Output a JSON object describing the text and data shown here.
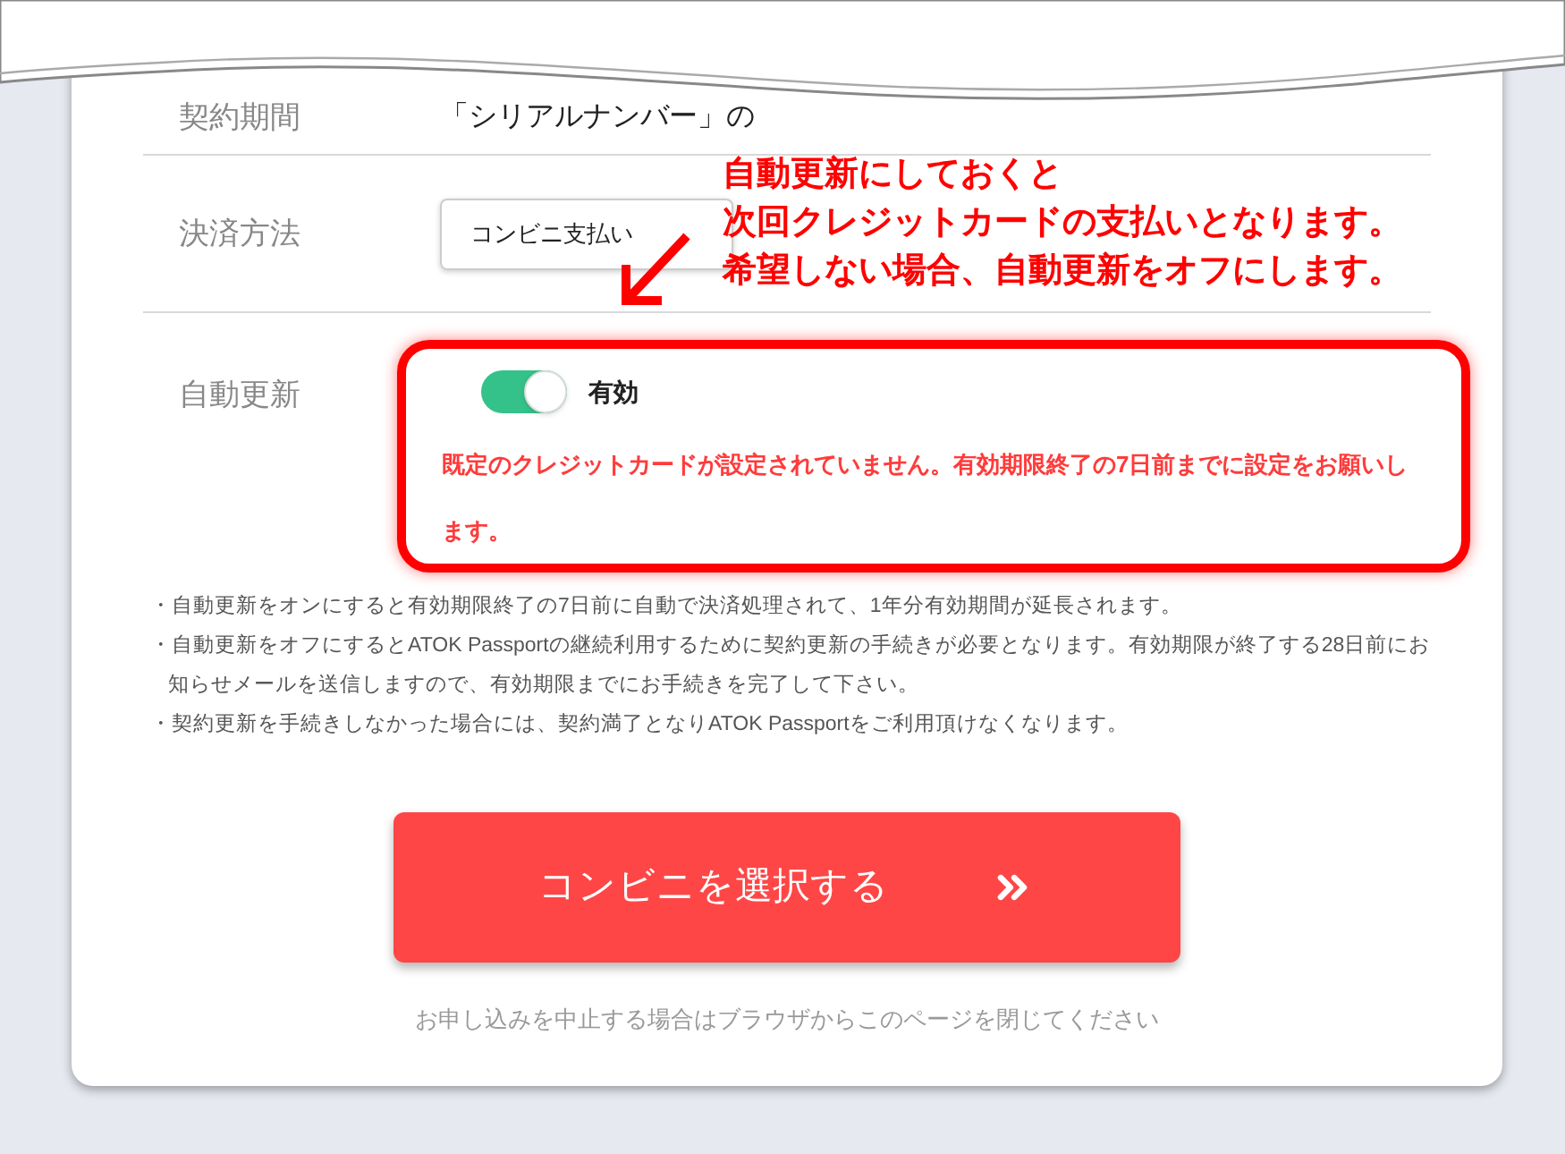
{
  "top_row": {
    "label": "契約期間",
    "value": "「シリアルナンバー」の"
  },
  "payment": {
    "label": "決済方法",
    "select_value": "コンビニ支払い"
  },
  "auto_renew": {
    "label": "自動更新",
    "toggle": {
      "on": true,
      "label": "有効"
    },
    "warning": "既定のクレジットカードが設定されていません。有効期限終了の7日前までに設定をお願いします。"
  },
  "notes": [
    "・自動更新をオンにすると有効期限終了の7日前に自動で決済処理されて、1年分有効期間が延長されます。",
    "・自動更新をオフにするとATOK Passportの継続利用するために契約更新の手続きが必要となります。有効期限が終了する28日前にお知らせメールを送信しますので、有効期限までにお手続きを完了して下さい。",
    "・契約更新を手続きしなかった場合には、契約満了となりATOK Passportをご利用頂けなくなります。"
  ],
  "submit_button": {
    "label": "コンビニを選択する"
  },
  "footer_note": "お申し込みを中止する場合はブラウザからこのページを閉じてください",
  "callout": {
    "lines": [
      "自動更新にしておくと",
      "次回クレジットカードの支払いとなります。",
      "希望しない場合、自動更新をオフにします。"
    ]
  }
}
